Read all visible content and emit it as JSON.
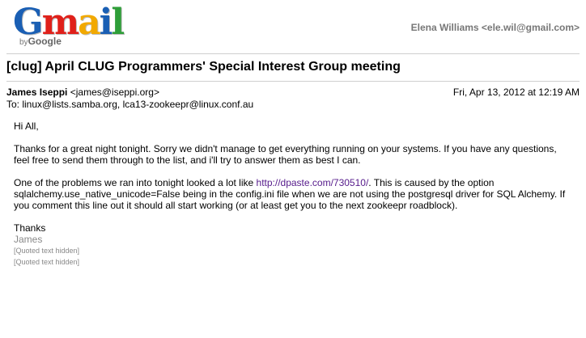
{
  "brand": {
    "letters": [
      {
        "ch": "G",
        "color": "#1a5fb4"
      },
      {
        "ch": "m",
        "color": "#e0201a"
      },
      {
        "ch": "a",
        "color": "#f2a900"
      },
      {
        "ch": "i",
        "color": "#1a5fb4"
      },
      {
        "ch": "l",
        "color": "#2e9e38"
      }
    ],
    "by": "by",
    "google": "Google"
  },
  "account": "Elena Williams <ele.wil@gmail.com>",
  "message": {
    "subject": "[clug] April CLUG Programmers' Special Interest Group meeting",
    "sender_name": "James Iseppi",
    "sender_email": "<james@iseppi.org>",
    "date": "Fri, Apr 13, 2012 at 12:19 AM",
    "to": "To: linux@lists.samba.org, lca13-zookeepr@linux.conf.au",
    "greeting": "Hi All,",
    "para1": "Thanks for a great night tonight. Sorry we didn't manage to get everything running on your systems. If you have any questions, feel free to send them through to the list, and i'll try to answer them as best I can.",
    "para2_before": "One of the problems we ran into tonight looked a lot like ",
    "para2_link": "http://dpaste.com/730510/",
    "para2_after": ". This is caused by the option sqlalchemy.use_native_unicode=False being in the config.ini file when we are not using the postgresql driver for SQL Alchemy. If you comment this line out it should all start working (or at least get you to the next zookeepr roadblock).",
    "thanks": "Thanks",
    "signature": "James",
    "quoted1": "[Quoted text hidden]",
    "quoted2": "[Quoted text hidden]"
  }
}
